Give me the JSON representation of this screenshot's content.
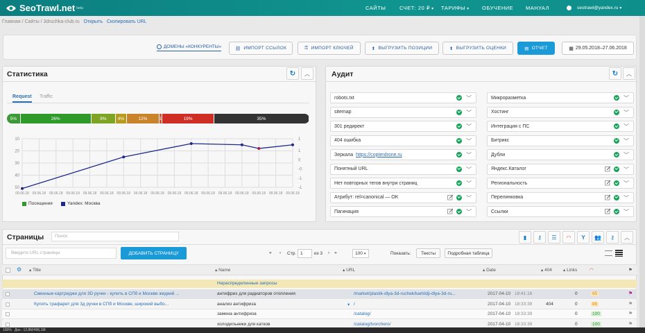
{
  "app": {
    "name": "SeoTrawl.net",
    "sup": "beta"
  },
  "nav": {
    "sites": "САЙТЫ",
    "account": "СЧЕТ: 20 ₽",
    "tariffs": "ТАРИФЫ",
    "training": "ОБУЧЕНИЕ",
    "manual": "МАНУАЛ",
    "user": "seotrawl@yandex.ru"
  },
  "breadcrumb": {
    "home": "Главная",
    "sites": "Сайты",
    "site": "3druchka-club.ru",
    "open": "Открыть",
    "copy": "Скопировать URL"
  },
  "toolbar": {
    "domains": "ДОМЕНЫ «КОНКУРЕНТЫ»",
    "import_links": "ИМПОРТ ССЫЛОК",
    "import_keys": "ИМПОРТ КЛЮЧЕЙ",
    "export_positions": "ВЫГРУЗИТЬ ПОЗИЦИИ",
    "export_scores": "ВЫГРУЗИТЬ ОЦЕНКИ",
    "report": "ОТЧЕТ",
    "date_range": "29.05.2018–27.06.2018"
  },
  "stats": {
    "title": "Статистика",
    "tabs": [
      "Request",
      "Traffic"
    ],
    "bar": [
      {
        "label": "5%",
        "value": 5,
        "color": "#3b9a36"
      },
      {
        "label": "26%",
        "value": 26,
        "color": "#2e9a2a"
      },
      {
        "label": "9%",
        "value": 9,
        "color": "#7da425"
      },
      {
        "label": "4%",
        "value": 4,
        "color": "#b89b1e"
      },
      {
        "label": "12%",
        "value": 12,
        "color": "#c9832a"
      },
      {
        "label": "1",
        "value": 1,
        "color": "#d4522c"
      },
      {
        "label": "19%",
        "value": 19,
        "color": "#cf2e25"
      },
      {
        "label": "35%",
        "value": 35,
        "color": "#333333"
      }
    ],
    "legend": [
      {
        "name": "Посещения",
        "color": "#2e9a2a"
      },
      {
        "name": "Yandex: Москва",
        "color": "#1e2a8a"
      }
    ]
  },
  "chart_data": {
    "type": "line",
    "x": [
      "09.06.18",
      "09.06.18",
      "09.06.18",
      "09.06.18",
      "09.06.18",
      "09.06.18",
      "09.06.18",
      "09.06.18",
      "09.06.18",
      "09.06.18",
      "09.06.18",
      "09.06.18",
      "09.06.18",
      "09.06.18",
      "09.06.18",
      "09.06.18",
      "09.06.18"
    ],
    "y_left_ticks": [
      "10",
      "20",
      "30",
      "40",
      "50"
    ],
    "y_right_ticks": [
      "1",
      "1",
      "0",
      "-0",
      "-1",
      "-1"
    ],
    "series": [
      {
        "name": "Yandex: Москва",
        "color": "#1e2a8a",
        "points": [
          [
            0,
            51
          ],
          [
            6,
            25
          ],
          [
            10,
            14
          ],
          [
            13,
            15
          ],
          [
            14,
            18
          ],
          [
            16,
            15
          ]
        ]
      }
    ],
    "ylim": [
      10,
      50
    ],
    "grid": true
  },
  "audit": {
    "title": "Аудит",
    "left": [
      {
        "label": "robots.txt"
      },
      {
        "label": "sitemap"
      },
      {
        "label": "301 редирект"
      },
      {
        "label": "404 ошибка"
      },
      {
        "label": "Зеркала",
        "link": "https://copterdrone.ru"
      },
      {
        "label": "Понятный URL"
      },
      {
        "label": "Нет повторных тегов внутри страниц"
      },
      {
        "label": "Атрибут: rel=canonical — OK",
        "edit": true
      },
      {
        "label": "Пагинация",
        "edit": true
      }
    ],
    "right": [
      {
        "label": "Микроразметка"
      },
      {
        "label": "Хостинг"
      },
      {
        "label": "Интеграция с ПС"
      },
      {
        "label": "Битрикс"
      },
      {
        "label": "Дубли"
      },
      {
        "label": "Яндекс.Каталог",
        "edit": true
      },
      {
        "label": "Региональность",
        "edit": true
      },
      {
        "label": "Перелинковка",
        "edit": true
      },
      {
        "label": "Ссылки",
        "edit": true
      }
    ]
  },
  "pages": {
    "title": "Страницы",
    "search_placeholder": "Поиск",
    "url_placeholder": "Введите URL страницы",
    "add_button": "ДОБАВИТЬ СТРАНИЦУ",
    "page_label": "Стр.",
    "page_value": "1",
    "of_label": "из 3",
    "per_page": "100",
    "show_label": "Показать:",
    "texts_button": "Тексты",
    "detailed_button": "Подробная таблица",
    "columns": {
      "title": "Title",
      "name": "Name",
      "url": "URL",
      "date": "Date",
      "c404": "404",
      "links": "Links"
    },
    "unassigned": "Нераспределенные запросы",
    "rows": [
      {
        "title": "Сменные картриджи для 3D ручки - купить в СПб и Москве жидкий ...",
        "name": "антифриз для радиаторов отопления",
        "url": "/market/plastik-dlya-3d-ruchek/kartridji-dlya-3d-ru...",
        "date": "2017-04-10",
        "time": "18:41:16",
        "c404": "",
        "links": "0",
        "score": "85",
        "scorecolor": "#e08a00"
      },
      {
        "title": "Купить трафарет для 3д ручки в СПб и Москве, широкий выбо...",
        "name": "анализ антифриза",
        "url": "/",
        "date": "2017-04-10",
        "time": "18:33:39",
        "c404": "404",
        "links": "0",
        "score": "85",
        "scorecolor": "#e08a00"
      },
      {
        "title": "",
        "name": "замена антифриза",
        "url": "/catalog/",
        "date": "2017-04-10",
        "time": "18:33:39",
        "c404": "",
        "links": "0",
        "score": "100",
        "scorecolor": "#2a9a2a"
      },
      {
        "title": "",
        "name": "холодильники для катков",
        "url": "/catalog/tvorchero/",
        "date": "2017-04-10",
        "time": "18:33:39",
        "c404": "",
        "links": "0",
        "score": "100",
        "scorecolor": "#2a9a2a"
      }
    ]
  },
  "status": {
    "zoom": "100%",
    "doc": "Док.: 12,8M/496,1M"
  }
}
